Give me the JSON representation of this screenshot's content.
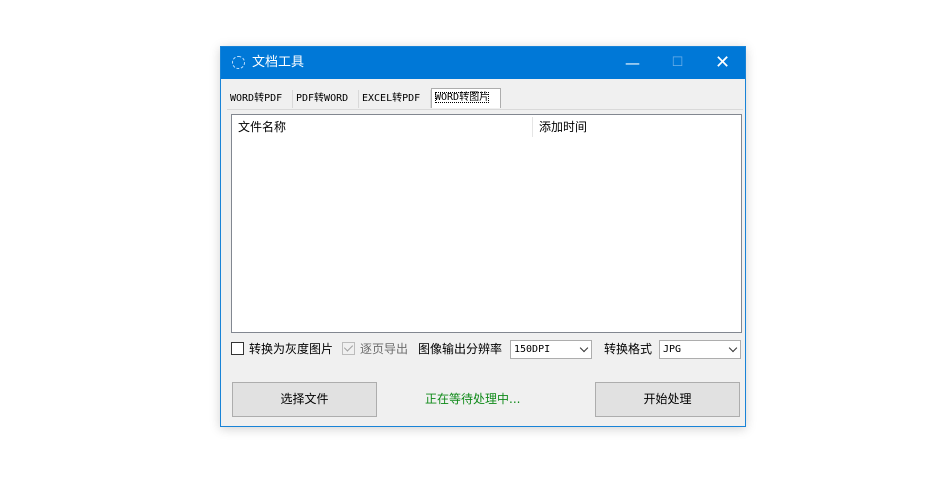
{
  "window": {
    "title": "文档工具",
    "minimize_glyph": "—",
    "maximize_glyph": "☐",
    "close_glyph": "✕",
    "accent_color": "#0078d7"
  },
  "tabs": [
    {
      "label": "WORD转PDF",
      "active": false
    },
    {
      "label": "PDF转WORD",
      "active": false
    },
    {
      "label": "EXCEL转PDF",
      "active": false
    },
    {
      "label": "WORD转图片",
      "active": true
    }
  ],
  "file_list": {
    "columns": [
      "文件名称",
      "添加时间"
    ],
    "rows": []
  },
  "options": {
    "grayscale_label": "转换为灰度图片",
    "grayscale_checked": false,
    "per_page_label": "逐页导出",
    "per_page_checked": true,
    "per_page_enabled": false,
    "resolution_label": "图像输出分辨率",
    "resolution_value": "150DPI",
    "format_label": "转换格式",
    "format_value": "JPG"
  },
  "actions": {
    "select_files_label": "选择文件",
    "start_label": "开始处理",
    "status_text": "正在等待处理中...",
    "status_color": "#0f8a19"
  }
}
